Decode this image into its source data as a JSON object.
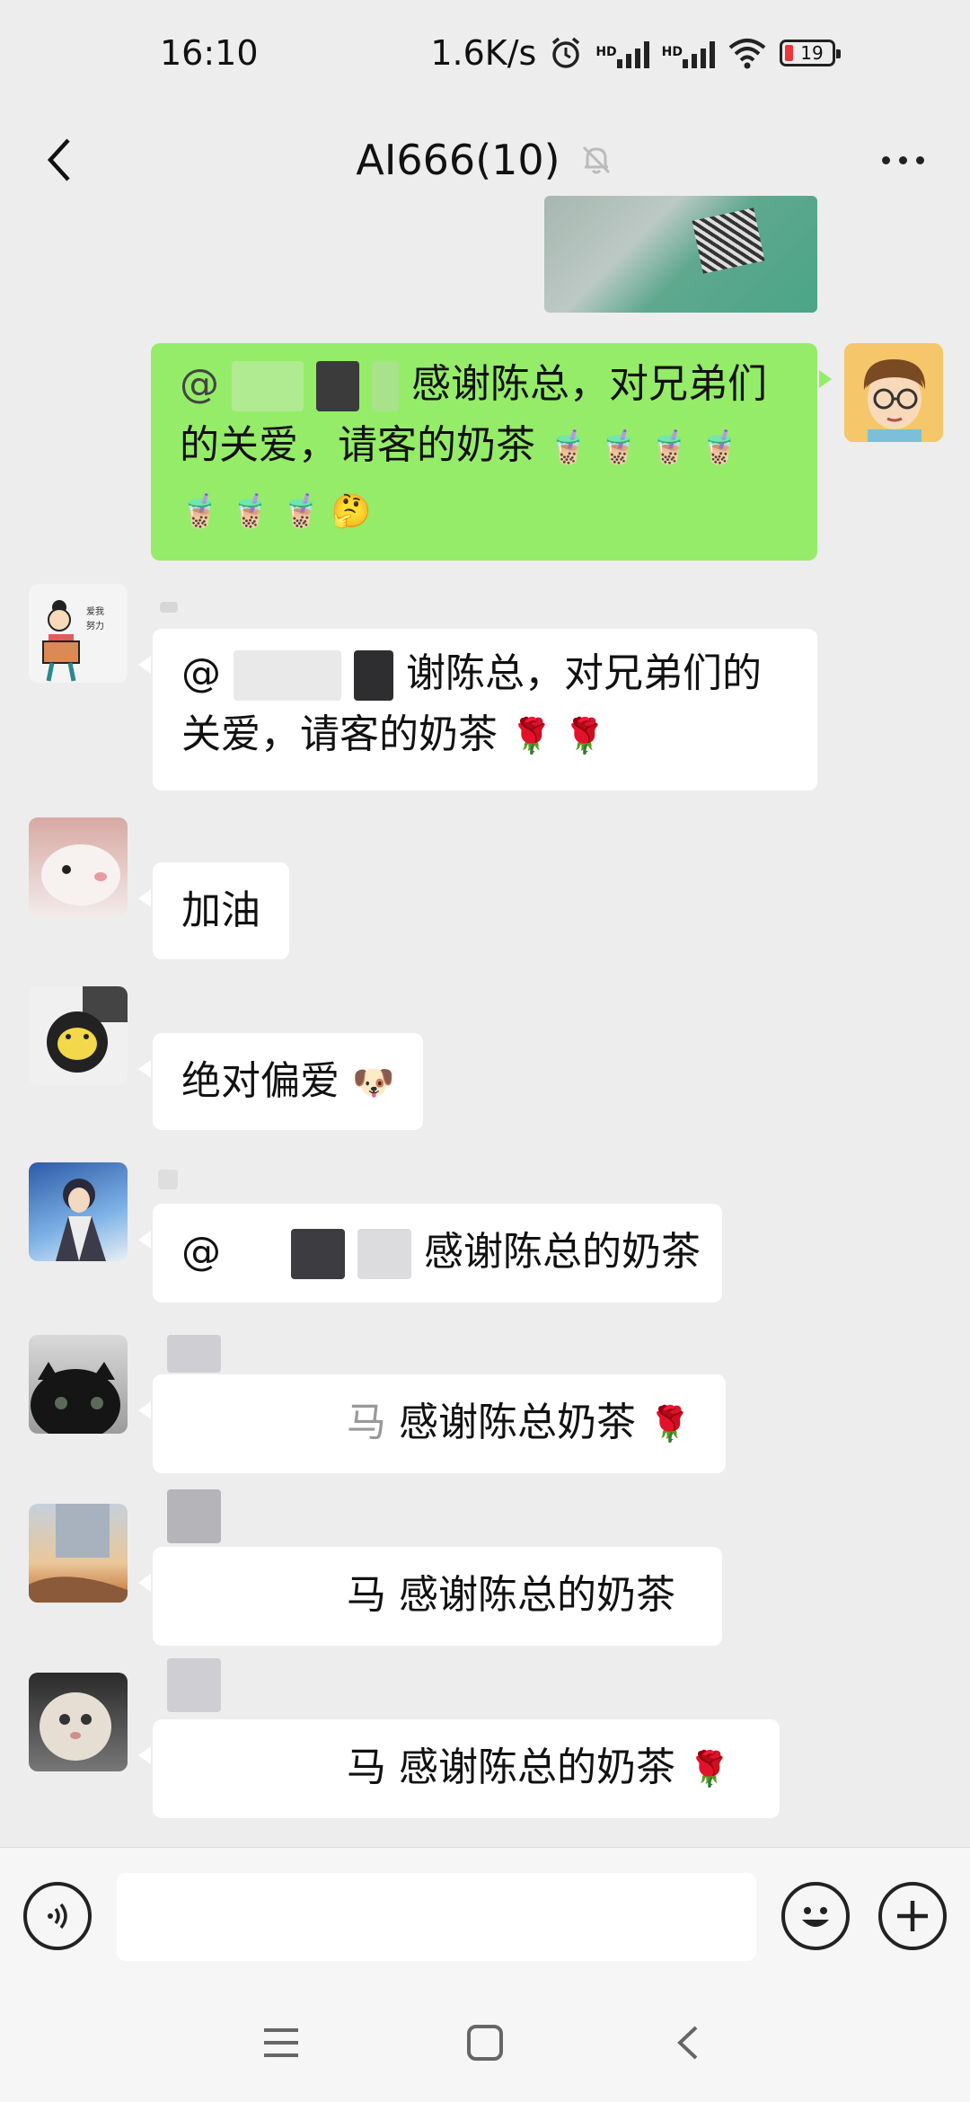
{
  "status_bar": {
    "time": "16:10",
    "net_speed": "1.6K/s",
    "signal_1_label": "HD",
    "signal_2_label": "HD",
    "battery_level": "19",
    "icons": [
      "alarm-icon",
      "signal-icon",
      "signal-icon",
      "wifi-icon",
      "battery-icon"
    ]
  },
  "header": {
    "title": "AI666(10)",
    "icons": [
      "back-icon",
      "mute-icon",
      "more-icon"
    ]
  },
  "messages": [
    {
      "side": "right",
      "type": "image",
      "avatar": "cartoon-glasses-avatar"
    },
    {
      "side": "right",
      "type": "text",
      "prefix": "@",
      "line1": "感谢陈总，对兄弟们",
      "line2": "的关爱，请客的奶茶",
      "emoji_row1": "🧋 🧋 🧋 🧋",
      "emoji_row2": "🧋 🧋 🧋 🤔"
    },
    {
      "side": "left",
      "type": "text",
      "prefix": "@",
      "line1": "谢陈总，对兄弟们的",
      "line2": "关爱，请客的奶茶",
      "emoji": "🌹 🌹"
    },
    {
      "side": "left",
      "type": "text",
      "text": "加油"
    },
    {
      "side": "left",
      "type": "text",
      "text": "绝对偏爱",
      "emoji": "🐶"
    },
    {
      "side": "left",
      "type": "text",
      "prefix": "@",
      "text": "感谢陈总的奶茶"
    },
    {
      "side": "left",
      "type": "text",
      "partial": "马",
      "text": "感谢陈总奶茶",
      "emoji": "🌹"
    },
    {
      "side": "left",
      "type": "text",
      "partial": "马",
      "text": "感谢陈总的奶茶"
    },
    {
      "side": "left",
      "type": "text",
      "partial": "马",
      "text": "感谢陈总的奶茶",
      "emoji": "🌹"
    }
  ],
  "input_bar": {
    "placeholder": "",
    "icons": [
      "voice-icon",
      "emoji-icon",
      "plus-icon"
    ]
  },
  "nav_bar": {
    "icons": [
      "menu-icon",
      "home-icon",
      "back-nav-icon"
    ]
  },
  "colors": {
    "background": "#ededed",
    "my_bubble": "#95ec69",
    "other_bubble": "#ffffff",
    "battery_low": "#e8383d"
  }
}
